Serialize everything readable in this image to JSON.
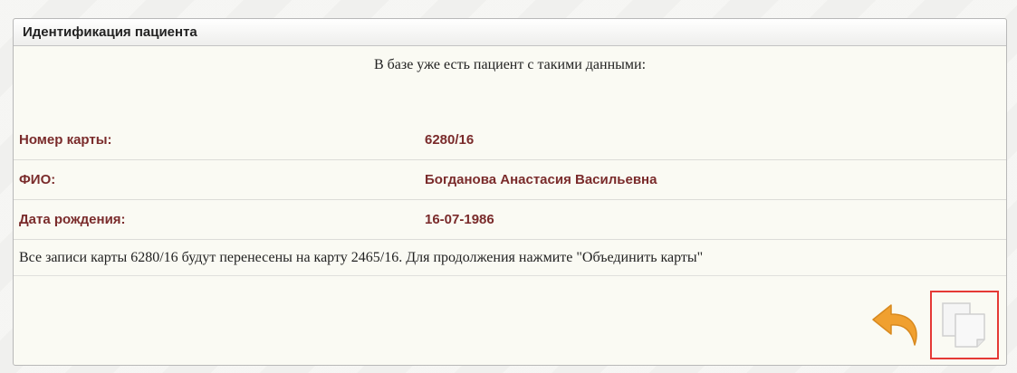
{
  "dialog": {
    "title": "Идентификация пациента",
    "intro": "В базе уже есть пациент с такими данными:",
    "rows": [
      {
        "label": "Номер карты:",
        "value": "6280/16"
      },
      {
        "label": "ФИО:",
        "value": "Богданова Анастасия Васильевна"
      },
      {
        "label": "Дата рождения:",
        "value": "16-07-1986"
      }
    ],
    "merge_note": "Все записи карты 6280/16 будут перенесены на карту 2465/16. Для продолжения нажмите \"Объединить карты\""
  },
  "actions": {
    "back_icon": "undo-arrow-icon",
    "merge_icon": "copy-pages-icon"
  },
  "colors": {
    "label_color": "#7a2b2b",
    "highlight_border": "#e53935",
    "arrow_color": "#f0a030"
  }
}
